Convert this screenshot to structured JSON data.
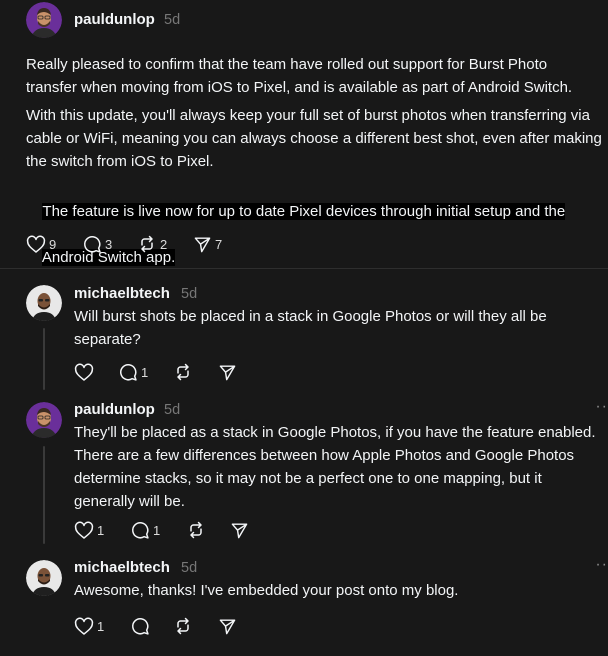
{
  "post": {
    "username": "pauldunlop",
    "time": "5d",
    "paragraphs": [
      "Really pleased to confirm that the team have rolled out support for Burst Photo\ntransfer when moving from iOS to Pixel, and is available as part of Android Switch.",
      "With this update, you'll always keep your full set of burst photos when transferring via\ncable or WiFi, meaning you can always choose a different best shot, even after making\nthe switch from iOS to Pixel."
    ],
    "highlight_lines": [
      "The feature is live now for up to date Pixel devices through initial setup and the",
      "Android Switch app."
    ],
    "likes": "9",
    "comments": "3",
    "reposts": "2",
    "shares": "7"
  },
  "replies": [
    {
      "username": "michaelbtech",
      "time": "5d",
      "text": "Will burst shots be placed in a stack in Google Photos or will they all be\nseparate?",
      "likes": "",
      "comments": "1"
    },
    {
      "username": "pauldunlop",
      "time": "5d",
      "text": "They'll be placed as a stack in Google Photos, if you have the feature enabled.\nThere are a few differences between how Apple Photos and Google Photos\ndetermine stacks, so it may not be a perfect one to one mapping, but it\ngenerally will be.",
      "likes": "1",
      "comments": "1"
    },
    {
      "username": "michaelbtech",
      "time": "5d",
      "text": "Awesome, thanks! I've embedded your post onto my blog.",
      "likes": "1",
      "comments": ""
    }
  ],
  "colors": {
    "background": "#181818",
    "text": "#f3f5f7",
    "muted": "#777777",
    "highlight": "#000000"
  }
}
